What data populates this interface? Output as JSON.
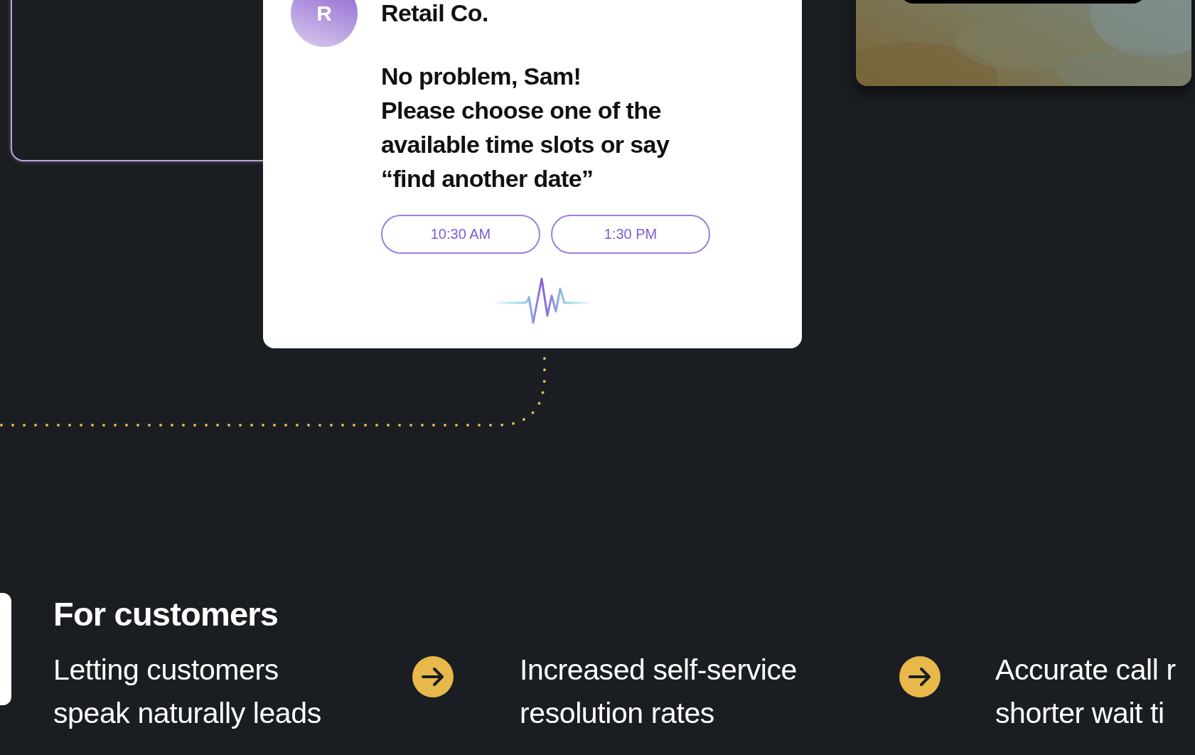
{
  "chat_card": {
    "sender_initial": "R",
    "sender": "Retail Co.",
    "greeting": "No problem, Sam!",
    "message": "Please choose one of the available time slots or say “find another date”",
    "time_slots": [
      "10:30 AM",
      "1:30 PM"
    ]
  },
  "section": {
    "title": "For customers",
    "benefits": [
      {
        "lines": [
          "Letting customers",
          "speak naturally leads"
        ]
      },
      {
        "lines": [
          "Increased self-service",
          "resolution rates"
        ]
      },
      {
        "lines": [
          "Accurate call r",
          "shorter wait ti"
        ]
      }
    ]
  }
}
